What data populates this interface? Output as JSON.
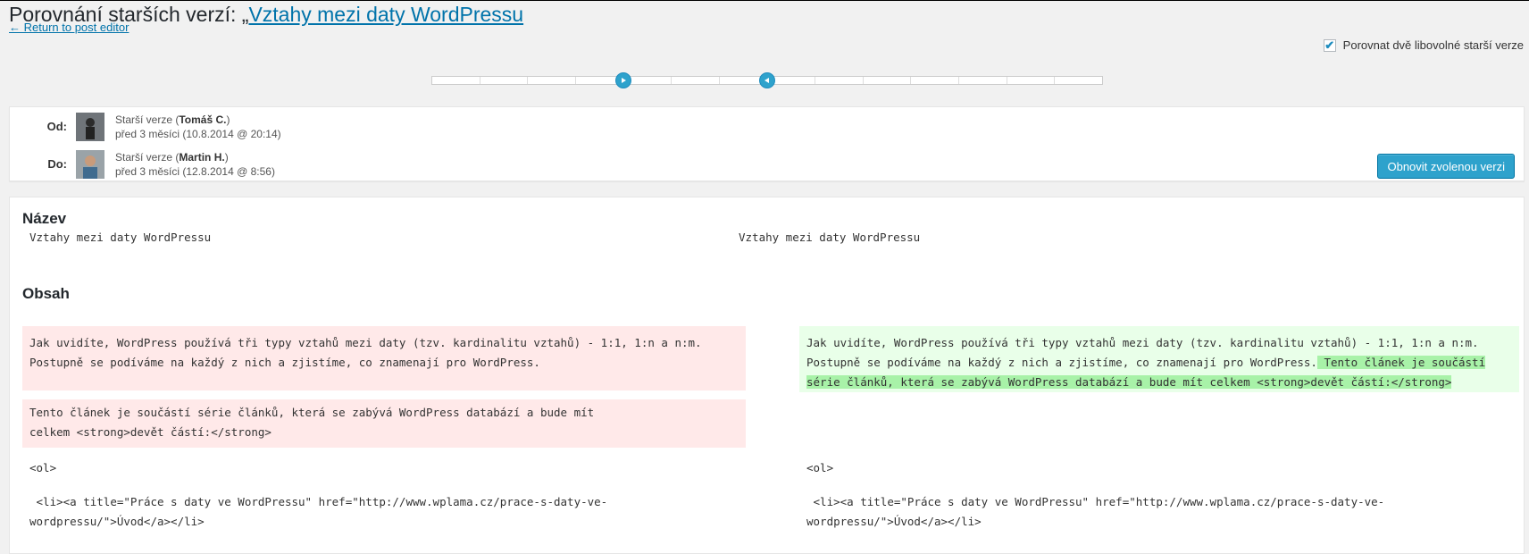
{
  "header": {
    "title_prefix": "Porovnání starších verzí: „",
    "title_link": "Vztahy mezi daty WordPressu",
    "back_link": "← Return to post editor",
    "compare_label": "Porovnat dvě libovolné starší verze",
    "compare_checked": true
  },
  "slider": {
    "ticks": 14,
    "from_index": 4,
    "to_index": 7
  },
  "meta": {
    "from": {
      "label": "Od:",
      "version_prefix": "Starší verze (",
      "author": "Tomáš C.",
      "version_suffix": ")",
      "time_ago": "před 3 měsíci",
      "date": "(10.8.2014 @ 20:14)"
    },
    "to": {
      "label": "Do:",
      "version_prefix": "Starší verze (",
      "author": "Martin H.",
      "version_suffix": ")",
      "time_ago": "před 3 měsíci",
      "date": "(12.8.2014 @ 8:56)"
    },
    "restore_button": "Obnovit zvolenou verzi"
  },
  "diff": {
    "title_heading": "Název",
    "content_heading": "Obsah",
    "left_title": "Vztahy mezi daty WordPressu",
    "right_title": "Vztahy mezi daty WordPressu",
    "left_del_1": "Jak uvidíte, WordPress používá tři typy vztahů mezi daty (tzv. kardinalitu vztahů) - 1:1, 1:n a n:m.\nPostupně se podíváme na každý z nich a zjistíme, co znamenají pro WordPress.",
    "left_del_2": "Tento článek je součástí série článků, která se zabývá WordPress databází a bude mít\ncelkem <strong>devět částí:</strong>",
    "right_ins_plain": "Jak uvidíte, WordPress používá tři typy vztahů mezi daty (tzv. kardinalitu vztahů) - 1:1, 1:n a n:m.\nPostupně se podíváme na každý z nich a zjistíme, co znamenají pro WordPress.",
    "right_ins_highlight": " Tento článek je součástí\nsérie článků, která se zabývá WordPress databází a bude mít celkem <strong>devět částí:</strong>",
    "left_ol": "<ol>",
    "right_ol": "<ol>",
    "left_li": " <li><a title=\"Práce s daty ve WordPressu\" href=\"http://www.wplama.cz/prace-s-daty-ve-\nwordpressu/\">Úvod</a></li>",
    "right_li": " <li><a title=\"Práce s daty ve WordPressu\" href=\"http://www.wplama.cz/prace-s-daty-ve-\nwordpressu/\">Úvod</a></li>"
  },
  "colors": {
    "accent": "#2ea2cc",
    "link": "#0073aa",
    "deleted": "#ffe9e9",
    "inserted": "#e9ffe9",
    "inserted_highlight": "#a8f2a8"
  }
}
